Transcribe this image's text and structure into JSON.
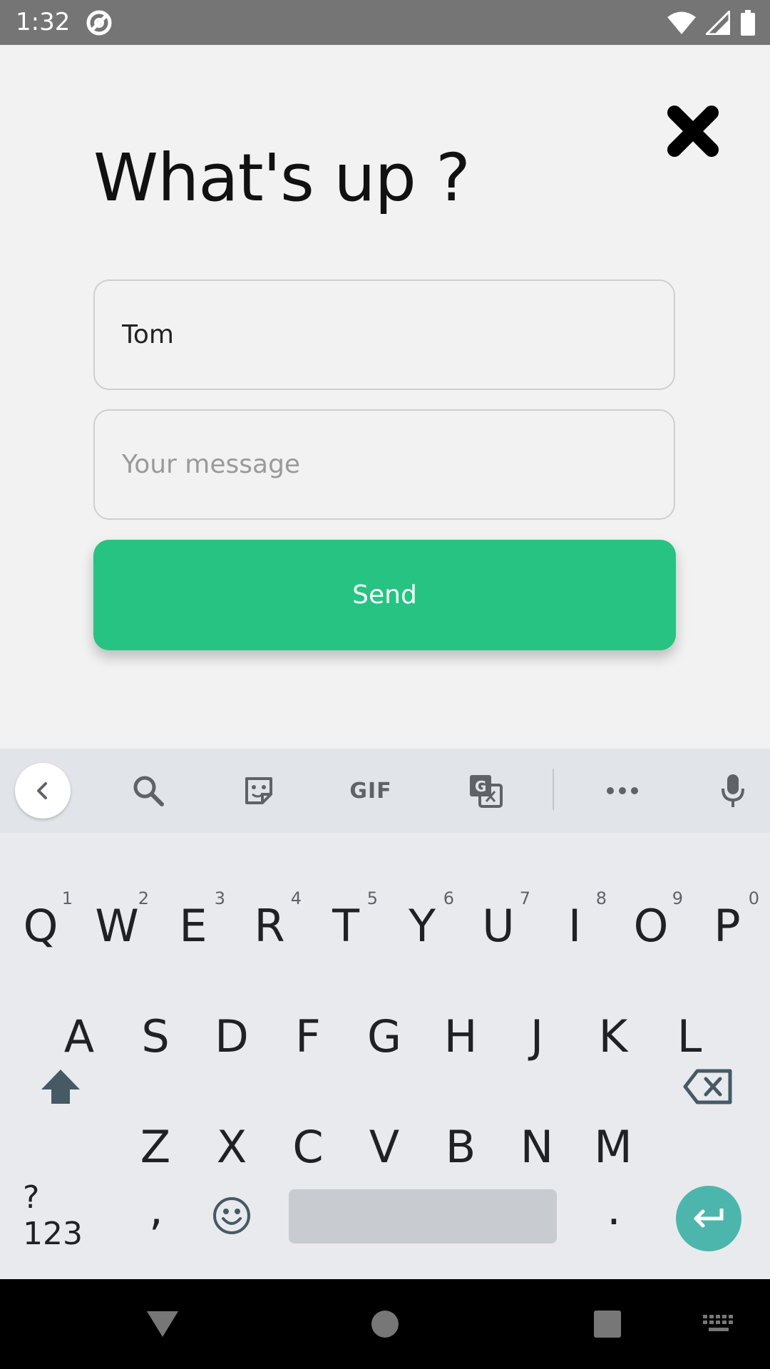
{
  "status_bar": {
    "time": "1:32",
    "icons": [
      "do-not-disturb-icon",
      "wifi-icon",
      "cellular-icon",
      "battery-icon"
    ]
  },
  "dialog": {
    "title": "What's up ?",
    "name_field": {
      "value": "Tom",
      "placeholder": ""
    },
    "message_field": {
      "value": "",
      "placeholder": "Your message"
    },
    "send_label": "Send",
    "accent_color": "#27c383"
  },
  "keyboard": {
    "toolbar_gif_label": "GIF",
    "row1": [
      {
        "key": "Q",
        "hint": "1"
      },
      {
        "key": "W",
        "hint": "2"
      },
      {
        "key": "E",
        "hint": "3"
      },
      {
        "key": "R",
        "hint": "4"
      },
      {
        "key": "T",
        "hint": "5"
      },
      {
        "key": "Y",
        "hint": "6"
      },
      {
        "key": "U",
        "hint": "7"
      },
      {
        "key": "I",
        "hint": "8"
      },
      {
        "key": "O",
        "hint": "9"
      },
      {
        "key": "P",
        "hint": "0"
      }
    ],
    "row2": [
      "A",
      "S",
      "D",
      "F",
      "G",
      "H",
      "J",
      "K",
      "L"
    ],
    "row3": [
      "Z",
      "X",
      "C",
      "V",
      "B",
      "N",
      "M"
    ],
    "symbols_label": "?123",
    "comma": ",",
    "period": ".",
    "enter_color": "#4db6ac"
  }
}
